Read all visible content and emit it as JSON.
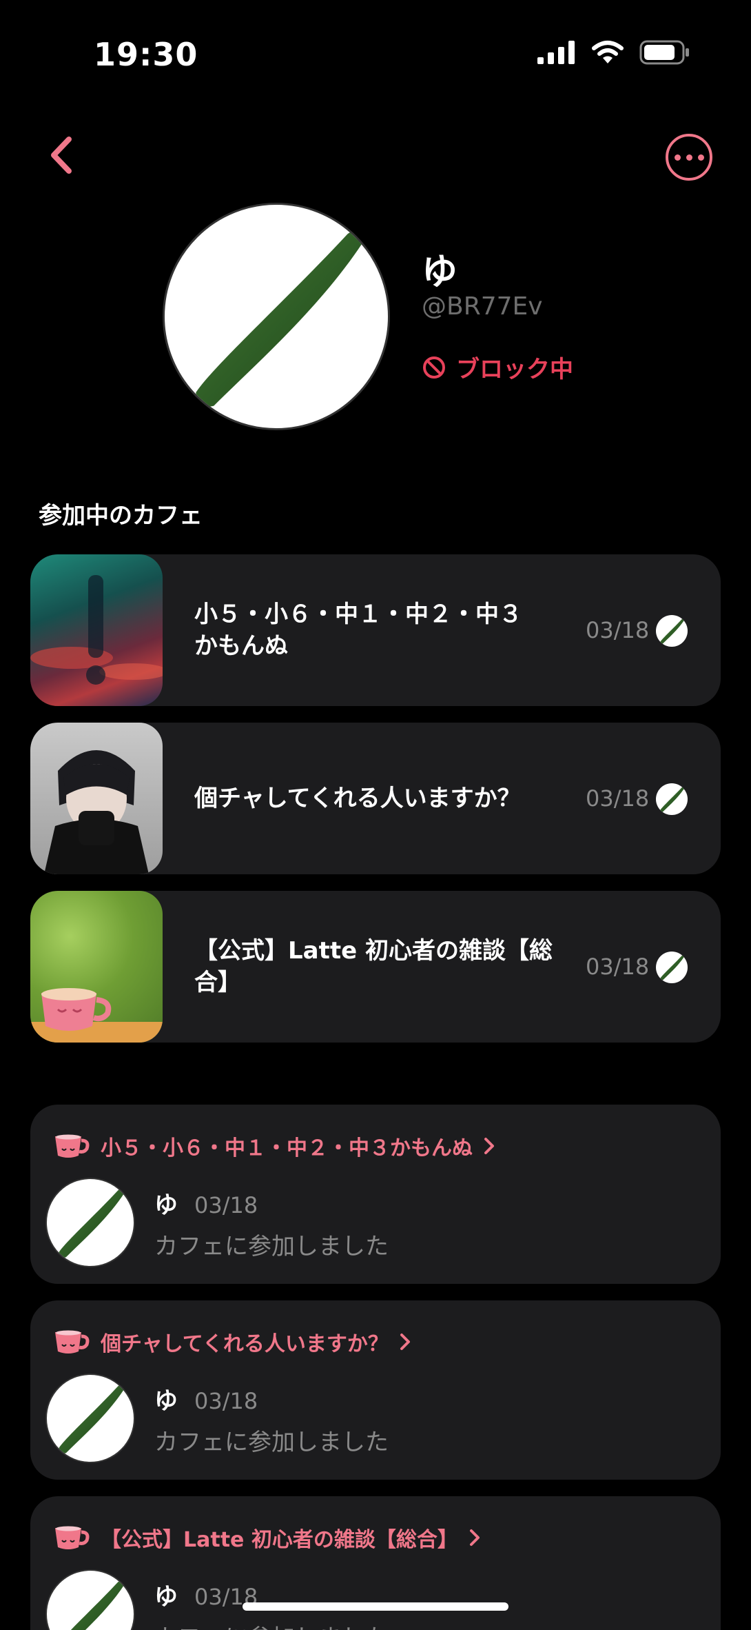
{
  "status_bar": {
    "time": "19:30"
  },
  "profile": {
    "name": "ゆ",
    "handle": "@BR77Ev",
    "block_label": "ブロック中"
  },
  "section_title": "参加中のカフェ",
  "cafes": [
    {
      "name": "小５・小６・中１・中２・中３\nかもんぬ",
      "date": "03/18"
    },
    {
      "name": "個チャしてくれる人いますか？",
      "date": "03/18"
    },
    {
      "name": "【公式】Latte 初心者の雑談【総\n合】",
      "date": "03/18"
    }
  ],
  "activities": [
    {
      "cafe": "小５・小６・中１・中２・中３かもんぬ",
      "user": "ゆ",
      "date": "03/18",
      "text": "カフェに参加しました"
    },
    {
      "cafe": "個チャしてくれる人いますか？",
      "user": "ゆ",
      "date": "03/18",
      "text": "カフェに参加しました"
    },
    {
      "cafe": "【公式】Latte 初心者の雑談【総合】",
      "user": "ゆ",
      "date": "03/18",
      "text": "カフェに参加しました"
    }
  ],
  "colors": {
    "accent": "#f0778a",
    "block_red": "#e8415a",
    "card": "#1c1c1e",
    "muted": "#8a8a8a"
  }
}
